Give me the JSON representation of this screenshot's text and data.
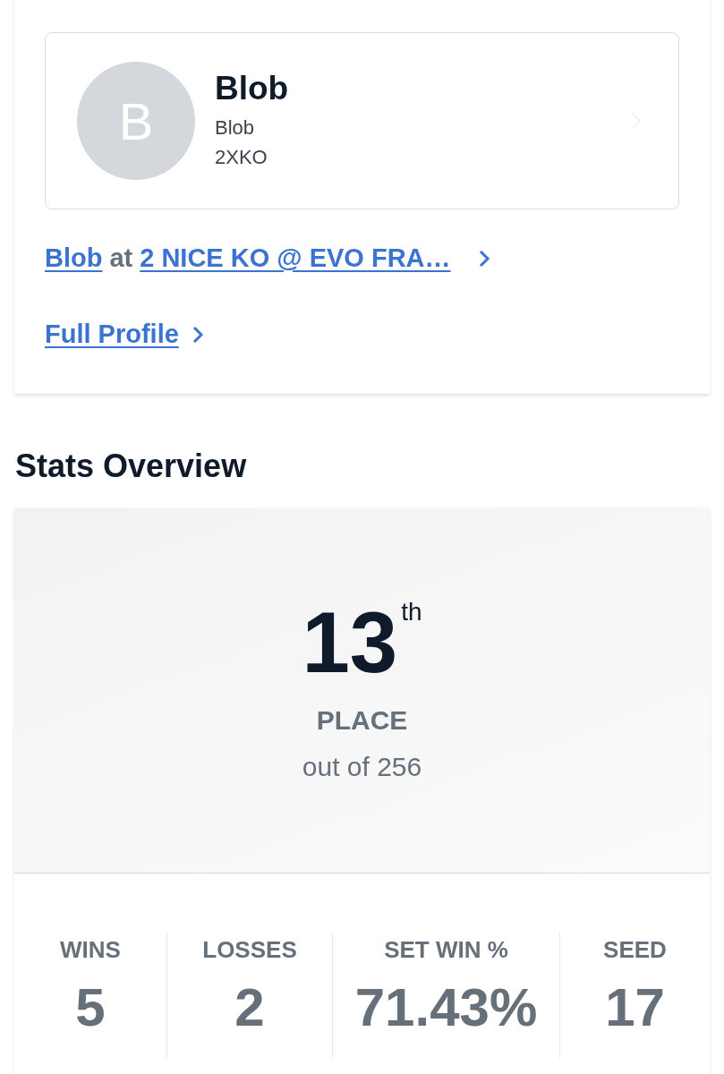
{
  "profile_card": {
    "avatar_letter": "B",
    "name": "Blob",
    "subtitle": "Blob",
    "game": "2XKO"
  },
  "entrant_link": {
    "player": "Blob",
    "connector": "at",
    "event": "2 NICE KO @ EVO FRA…"
  },
  "full_profile_link": "Full Profile",
  "stats_title": "Stats Overview",
  "placement": {
    "rank": "13",
    "suffix": "th",
    "label": "PLACE",
    "total": "out of 256"
  },
  "stats": [
    {
      "label": "WINS",
      "value": "5"
    },
    {
      "label": "LOSSES",
      "value": "2"
    },
    {
      "label": "SET WIN %",
      "value": "71.43%"
    },
    {
      "label": "SEED",
      "value": "17"
    }
  ]
}
